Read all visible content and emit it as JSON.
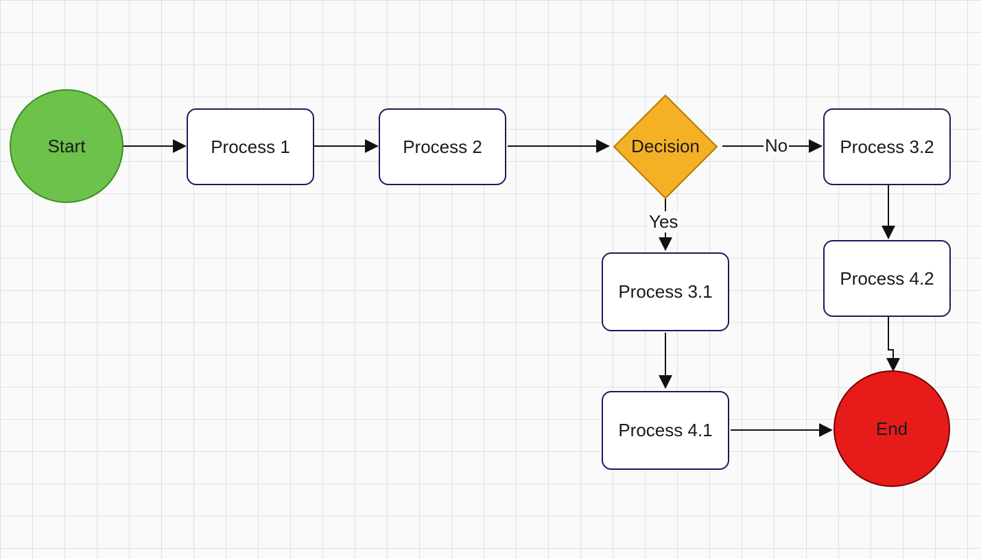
{
  "nodes": {
    "start": "Start",
    "p1": "Process 1",
    "p2": "Process 2",
    "decision": "Decision",
    "p31": "Process 3.1",
    "p32": "Process 3.2",
    "p41": "Process 4.1",
    "p42": "Process 4.2",
    "end": "End"
  },
  "edges": {
    "yes": "Yes",
    "no": "No"
  }
}
